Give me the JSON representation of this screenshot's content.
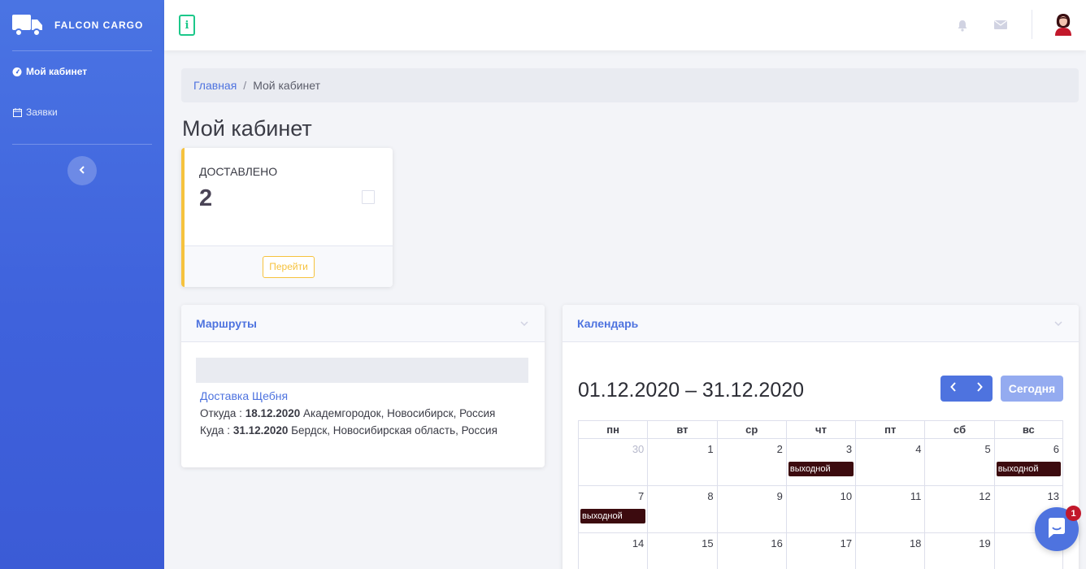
{
  "brand": {
    "name": "FALCON CARGO",
    "icon": "truck-icon"
  },
  "sidebar": {
    "items": [
      {
        "label": "Мой кабинет",
        "icon": "dashboard-icon",
        "active": true
      },
      {
        "label": "Заявки",
        "icon": "calendar-icon",
        "active": false
      }
    ],
    "collapse_icon": "chevron-left-icon"
  },
  "topbar": {
    "info_label": "i",
    "bell_icon": "bell-icon",
    "mail_icon": "envelope-icon",
    "avatar_icon": "user-avatar-icon"
  },
  "breadcrumb": {
    "home": "Главная",
    "separator": "/",
    "current": "Мой кабинет"
  },
  "page": {
    "title": "Мой кабинет"
  },
  "stat": {
    "label": "ДОСТАВЛЕНО",
    "value": "2",
    "button": "Перейти",
    "accent": "#f6c23e"
  },
  "routes": {
    "title": "Маршруты",
    "item": {
      "name": "Доставка Щебня",
      "from_label": "Откуда :",
      "from_date": "18.12.2020",
      "from_place": "Академгородок, Новосибирск, Россия",
      "to_label": "Куда :",
      "to_date": "31.12.2020",
      "to_place": "Бердск, Новосибирская область, Россия"
    }
  },
  "calendar": {
    "title": "Календарь",
    "range": "01.12.2020 – 31.12.2020",
    "today_button": "Сегодня",
    "weekdays": [
      "пн",
      "вт",
      "ср",
      "чт",
      "пт",
      "сб",
      "вс"
    ],
    "rows": [
      [
        {
          "d": "30",
          "other": true
        },
        {
          "d": "1"
        },
        {
          "d": "2"
        },
        {
          "d": "3",
          "event": "выходной"
        },
        {
          "d": "4"
        },
        {
          "d": "5"
        },
        {
          "d": "6",
          "event": "выходной"
        }
      ],
      [
        {
          "d": "7",
          "event": "выходной"
        },
        {
          "d": "8"
        },
        {
          "d": "9"
        },
        {
          "d": "10"
        },
        {
          "d": "11"
        },
        {
          "d": "12"
        },
        {
          "d": "13"
        }
      ],
      [
        {
          "d": "14"
        },
        {
          "d": "15"
        },
        {
          "d": "16"
        },
        {
          "d": "17"
        },
        {
          "d": "18"
        },
        {
          "d": "19"
        },
        {
          "d": ""
        }
      ]
    ]
  },
  "chat": {
    "badge": "1",
    "icon": "chat-icon"
  },
  "colors": {
    "primary": "#4e73df",
    "success": "#1cc88a",
    "warning": "#f6c23e",
    "event": "#3c0b0f"
  }
}
